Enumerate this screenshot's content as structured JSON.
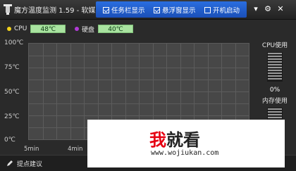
{
  "window": {
    "title": "魔方温度监测 1.59 - 软媒",
    "options": [
      {
        "label": "任务栏显示",
        "checked": true
      },
      {
        "label": "悬浮窗显示",
        "checked": true
      },
      {
        "label": "开机启动",
        "checked": false
      }
    ],
    "buttons": {
      "menu": "▾",
      "settings": "⚙",
      "close": "✕"
    }
  },
  "legend": {
    "cpu": {
      "label": "CPU",
      "value": "48℃",
      "color": "#f2d21b"
    },
    "disk": {
      "label": "硬盘",
      "value": "40℃",
      "color": "#b13bd6"
    }
  },
  "chart_data": {
    "type": "line",
    "yticks": [
      "100℃",
      "75℃",
      "50℃",
      "25℃",
      "0℃"
    ],
    "ylim": [
      0,
      100
    ],
    "xticks": [
      "5min",
      "4min"
    ],
    "grid": true,
    "series": []
  },
  "side": {
    "cpu_title": "CPU使用",
    "cpu_value": "0%",
    "mem_title": "内存使用"
  },
  "statusbar": {
    "label": "提点建议"
  },
  "watermark": {
    "logo_red": "我",
    "logo_rest": "就看",
    "url": "www.wojiukan.com"
  }
}
